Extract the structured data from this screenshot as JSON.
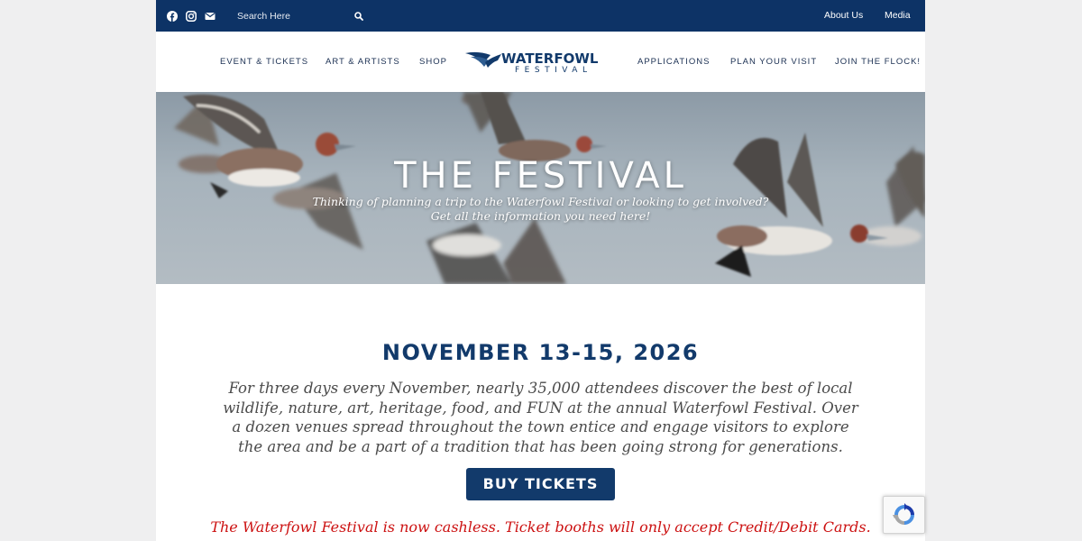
{
  "topbar": {
    "social_icons": [
      "facebook-icon",
      "instagram-icon",
      "email-icon"
    ],
    "search": {
      "placeholder": "Search Here",
      "value": ""
    },
    "links": {
      "about": "About Us",
      "media": "Media"
    }
  },
  "nav": {
    "left": [
      "EVENT & TICKETS",
      "ART & ARTISTS",
      "SHOP"
    ],
    "right": [
      "APPLICATIONS",
      "PLAN YOUR VISIT",
      "JOIN THE FLOCK!"
    ]
  },
  "logo": {
    "line1": "WATERFOWL",
    "line2": "FESTIVAL"
  },
  "hero": {
    "title": "THE FESTIVAL",
    "subtitle_line1": "Thinking of planning a trip to the Waterfowl Festival or looking to get involved?",
    "subtitle_line2": "Get all the information you need here!"
  },
  "content": {
    "date_heading": "NOVEMBER 13-15, 2026",
    "intro": "For three days every November, nearly 35,000 attendees discover the best of local wildlife, nature, art, heritage, food, and FUN at the annual Waterfowl Festival. Over a dozen venues spread throughout the town entice and engage visitors to explore the area and be a part of a tradition that has been going strong for generations.",
    "buy_button": "BUY TICKETS",
    "cashless_notice": "The Waterfowl Festival is now cashless. Ticket booths will only accept Credit/Debit Cards."
  },
  "colors": {
    "navy": "#0d3366",
    "heading": "#123a6b",
    "notice_red": "#cc1111",
    "body_text": "#4b4b4b"
  }
}
